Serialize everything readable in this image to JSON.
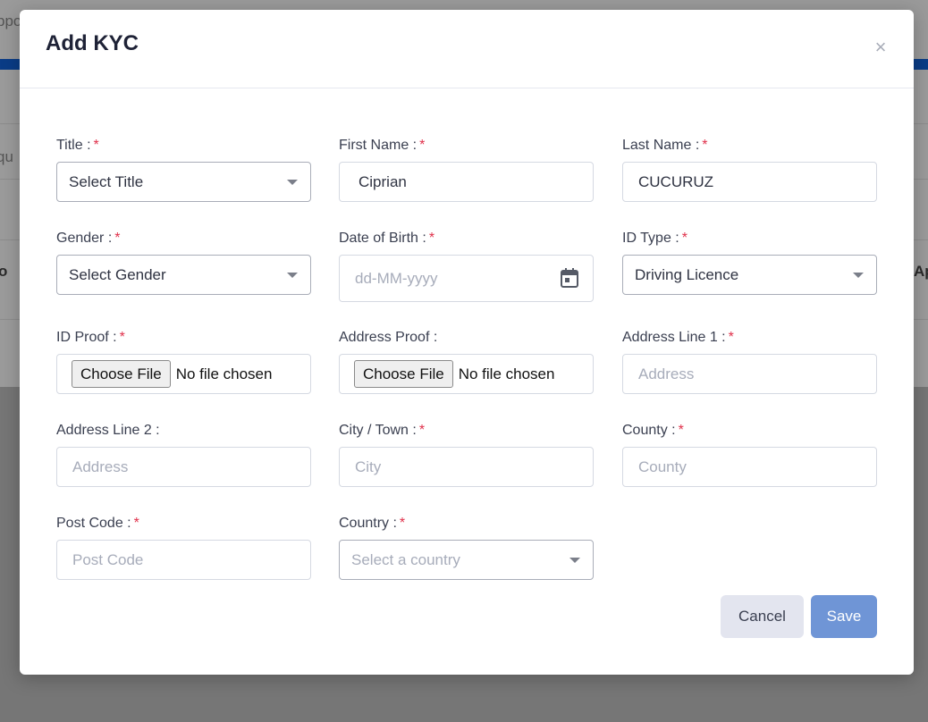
{
  "background": {
    "fragment_top": "ppo",
    "fragment_mid": "qu",
    "fragment_left": "o",
    "fragment_right": "Ap"
  },
  "modal": {
    "title": "Add KYC",
    "close_glyph": "×",
    "required_mark": "*",
    "fields": {
      "title": {
        "label": "Title :",
        "value": "Select Title"
      },
      "first_name": {
        "label": "First Name :",
        "value": "Ciprian"
      },
      "last_name": {
        "label": "Last Name :",
        "value": "CUCURUZ"
      },
      "gender": {
        "label": "Gender :",
        "value": "Select Gender"
      },
      "dob": {
        "label": "Date of Birth :",
        "placeholder": "dd-MM-yyyy"
      },
      "id_type": {
        "label": "ID Type :",
        "value": "Driving Licence"
      },
      "id_proof": {
        "label": "ID Proof :",
        "button": "Choose File",
        "status": "No file chosen"
      },
      "address_proof": {
        "label": "Address Proof :",
        "button": "Choose File",
        "status": "No file chosen"
      },
      "address_line1": {
        "label": "Address Line 1 :",
        "placeholder": "Address"
      },
      "address_line2": {
        "label": "Address Line 2 :",
        "placeholder": "Address"
      },
      "city": {
        "label": "City / Town :",
        "placeholder": "City"
      },
      "county": {
        "label": "County :",
        "placeholder": "County"
      },
      "post_code": {
        "label": "Post Code :",
        "placeholder": "Post Code"
      },
      "country": {
        "label": "Country :",
        "placeholder": "Select a country"
      }
    },
    "buttons": {
      "cancel": "Cancel",
      "save": "Save"
    }
  },
  "colors": {
    "required": "#e0314b",
    "save_button": "#6f95d6",
    "cancel_button": "#e3e5ef",
    "header_bar": "#0a3c86"
  }
}
